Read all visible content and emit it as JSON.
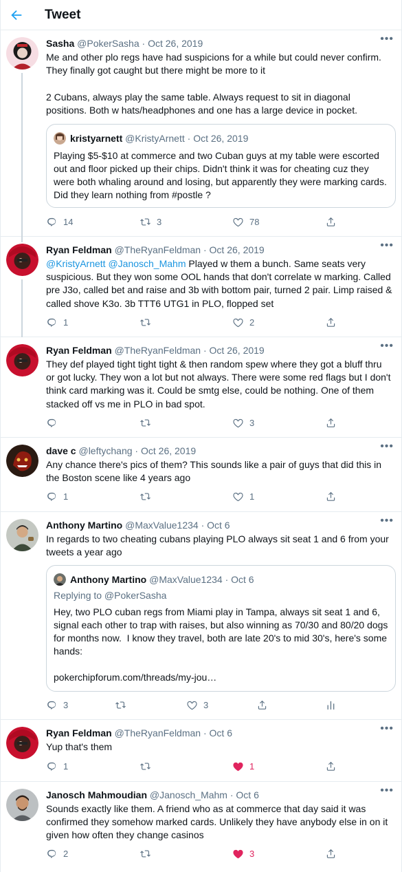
{
  "header": {
    "title": "Tweet"
  },
  "tweets": [
    {
      "name": "Sasha",
      "handle": "@PokerSasha",
      "time": "Oct 26, 2019",
      "text": "Me and other plo regs have had suspicions for a while but could never confirm. They finally got caught but there might be more to it\n\n2 Cubans, always play the same table. Always request to sit in diagonal positions. Both w hats/headphones and one has a large device in pocket.",
      "quote": {
        "name": "kristyarnett",
        "handle": "@KristyArnett",
        "time": "Oct 26, 2019",
        "text": "Playing $5-$10 at commerce and two Cuban guys at my table were escorted out and floor picked up their chips. Didn't think it was for cheating cuz they were both whaling around and losing, but apparently they were marking cards. Did they learn nothing from #postle ?"
      },
      "replies": "14",
      "retweets": "3",
      "likes": "78"
    },
    {
      "name": "Ryan Feldman",
      "handle": "@TheRyanFeldman",
      "time": "Oct 26, 2019",
      "mentions": "@KristyArnett @Janosch_Mahm",
      "text": " Played w them a bunch. Same seats very suspicious. But they won some OOL hands that don't correlate w marking. Called pre J3o, called bet and raise and 3b with bottom pair, turned 2 pair. Limp raised & called shove K3o. 3b TTT6 UTG1 in PLO, flopped set",
      "replies": "1",
      "retweets": "",
      "likes": "2"
    },
    {
      "name": "Ryan Feldman",
      "handle": "@TheRyanFeldman",
      "time": "Oct 26, 2019",
      "text": "They def played tight tight tight & then random spew where they got a bluff thru or got lucky. They won a lot but not always. There were some red flags but I don't think card marking was it. Could be smtg else, could be nothing. One of them stacked off vs me in PLO in bad spot.",
      "replies": "",
      "retweets": "",
      "likes": "3"
    },
    {
      "name": "dave c",
      "handle": "@leftychang",
      "time": "Oct 26, 2019",
      "text": "Any chance there's pics of them? This sounds like a pair of guys that did this in the Boston scene like 4 years ago",
      "replies": "1",
      "retweets": "",
      "likes": "1"
    },
    {
      "name": "Anthony Martino",
      "handle": "@MaxValue1234",
      "time": "Oct 6",
      "text": "In regards to two cheating cubans playing PLO always sit seat 1 and 6 from your tweets a year ago",
      "quote": {
        "name": "Anthony Martino",
        "handle": "@MaxValue1234",
        "time": "Oct 6",
        "replying": "Replying to @PokerSasha",
        "text": "Hey, two PLO cuban regs from Miami play in Tampa, always sit seat 1 and 6, signal each other to trap with raises, but also winning as 70/30 and 80/20 dogs for months now.  I know they travel, both are late 20's to mid 30's, here's some hands:\n\npokerchipforum.com/threads/my-jou…"
      },
      "replies": "3",
      "retweets": "",
      "likes": "3"
    },
    {
      "name": "Ryan Feldman",
      "handle": "@TheRyanFeldman",
      "time": "Oct 6",
      "text": "Yup that's them",
      "replies": "1",
      "retweets": "",
      "likes": "1",
      "liked": true
    },
    {
      "name": "Janosch Mahmoudian",
      "handle": "@Janosch_Mahm",
      "time": "Oct 6",
      "text": "Sounds exactly like them. A friend who as at commerce that day said it was confirmed they somehow marked cards. Unlikely they have anybody else in on it given how often they change casinos",
      "replies": "2",
      "retweets": "",
      "likes": "3",
      "liked": true
    }
  ],
  "colors": {
    "accent": "#1da1f2",
    "like": "#e0245e",
    "muted": "#5b7083"
  },
  "icons": [
    "back-arrow-icon",
    "more-icon",
    "reply-icon",
    "retweet-icon",
    "like-icon",
    "share-icon",
    "analytics-icon"
  ]
}
